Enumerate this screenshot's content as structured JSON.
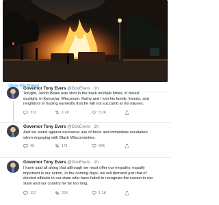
{
  "show_thread": "Show this thread",
  "tweets": [
    {
      "name": "Governor Tony Evers",
      "handle": "@GovEvers",
      "time": "1h",
      "lines": [
        "Tonight, Jacob Blake was shot in the back multiple times, in broad",
        "daylight, in Kenosha, Wisconsin. Kathy and I join his family, friends, and",
        "neighbors in hoping earnestly that he will not succumb to his injuries."
      ],
      "replies": "311",
      "retweets": "1.2K",
      "likes": "3.2K"
    },
    {
      "name": "Governor Tony Evers",
      "handle": "@GovEvers",
      "time": "1h",
      "lines": [
        "And we stand against excessive use of force and immediate escalation",
        "when engaging with Black Wisconsinites."
      ],
      "replies": "46",
      "retweets": "171",
      "likes": "945"
    },
    {
      "name": "Governor Tony Evers",
      "handle": "@GovEvers",
      "time": "1h",
      "lines": [
        "I have said all along that although we must offer our empathy, equally",
        "important is our action. In the coming days, we will demand just that of",
        "elected officials in our state who have failed to recognize the racism in our",
        "state and our country for far too long."
      ],
      "replies": "117",
      "retweets": "224",
      "likes": "1.1K"
    }
  ],
  "icons": [
    "reply-icon",
    "retweet-icon",
    "like-icon",
    "share-icon"
  ],
  "colors": {
    "link": "#1da1f2",
    "muted": "#657786",
    "fire": "#ff9a2e"
  }
}
